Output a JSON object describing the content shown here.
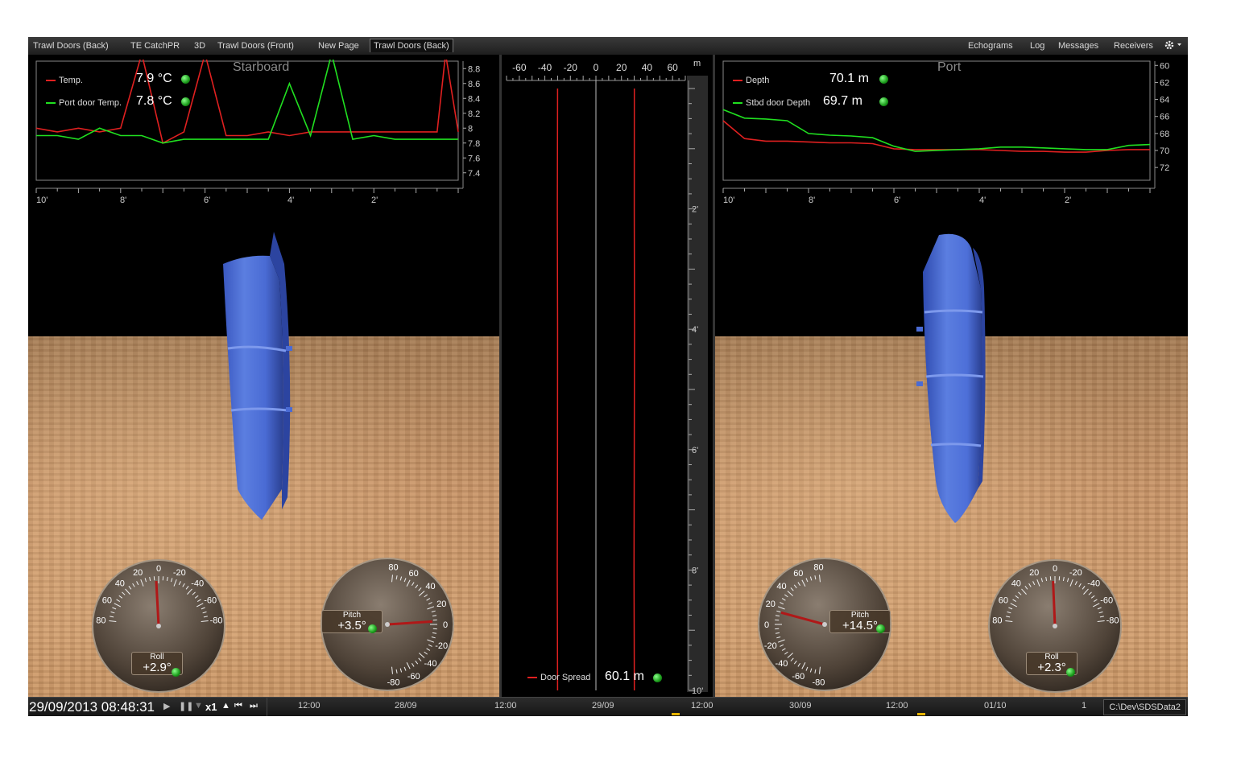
{
  "tabs": {
    "left": [
      {
        "label": "Trawl Doors (Back)"
      },
      {
        "label": "TE CatchPR"
      },
      {
        "label": "3D"
      },
      {
        "label": "Trawl Doors (Front)"
      },
      {
        "label": "New Page"
      },
      {
        "label": "Trawl Doors (Back)"
      }
    ],
    "active_index": 5,
    "right": [
      {
        "label": "Echograms"
      },
      {
        "label": "Log"
      },
      {
        "label": "Messages"
      },
      {
        "label": "Receivers"
      }
    ],
    "settings_icon": "gear-icon"
  },
  "starboard": {
    "title": "Starboard",
    "legend": [
      {
        "label": "Temp.",
        "value": "7.9 °C",
        "color": "#e02020"
      },
      {
        "label": "Port door Temp.",
        "value": "7.8 °C",
        "color": "#20e020"
      }
    ],
    "x_ticks": [
      "10'",
      "8'",
      "6'",
      "4'",
      "2'"
    ],
    "y_ticks": [
      "8.8",
      "8.6",
      "8.4",
      "8.2",
      "8",
      "7.8",
      "7.6",
      "7.4"
    ],
    "roll": {
      "label": "Roll",
      "value": "+2.9°",
      "deg": 2.9
    },
    "pitch": {
      "label": "Pitch",
      "value": "+3.5°",
      "deg": 3.5
    },
    "roll_scale": [
      "80",
      "60",
      "40",
      "20",
      "0",
      "-20",
      "-40",
      "-60",
      "-80"
    ],
    "pitch_scale": [
      "80",
      "60",
      "40",
      "20",
      "0",
      "-20",
      "-40",
      "-60",
      "-80"
    ]
  },
  "port": {
    "title": "Port",
    "legend": [
      {
        "label": "Depth",
        "value": "70.1 m",
        "color": "#e02020"
      },
      {
        "label": "Stbd door Depth",
        "value": "69.7 m",
        "color": "#20e020"
      }
    ],
    "x_ticks": [
      "10'",
      "8'",
      "6'",
      "4'",
      "2'"
    ],
    "y_ticks": [
      "60",
      "62",
      "64",
      "66",
      "68",
      "70",
      "72"
    ],
    "pitch": {
      "label": "Pitch",
      "value": "+14.5°",
      "deg": 14.5
    },
    "roll": {
      "label": "Roll",
      "value": "+2.3°",
      "deg": 2.3
    },
    "pitch_scale": [
      "80",
      "60",
      "40",
      "20",
      "0",
      "-20",
      "-40",
      "-60",
      "-80"
    ],
    "roll_scale": [
      "80",
      "60",
      "40",
      "20",
      "0",
      "-20",
      "-40",
      "-60",
      "-80"
    ]
  },
  "spread": {
    "x_ticks": [
      "-60",
      "-40",
      "-20",
      "0",
      "20",
      "40",
      "60"
    ],
    "unit": "m",
    "y_ticks": [
      "2'",
      "4'",
      "6'",
      "8'",
      "10'"
    ],
    "legend_label": "Door Spread",
    "value": "60.1 m",
    "color": "#e02020"
  },
  "status": {
    "datetime": "29/09/2013 08:48:31",
    "speed": "x1",
    "timeline": [
      "12:00",
      "28/09",
      "12:00",
      "29/09",
      "12:00",
      "30/09",
      "12:00",
      "01/10",
      "1"
    ],
    "path": "C:\\Dev\\SDSData2"
  },
  "chart_data": [
    {
      "type": "line",
      "title": "Starboard",
      "x": [
        10,
        9.5,
        9,
        8.5,
        8,
        7.5,
        7,
        6.5,
        6,
        5.5,
        5,
        4.5,
        4,
        3.5,
        3,
        2.5,
        2,
        1.5,
        1,
        0.5,
        0.3,
        0
      ],
      "series": [
        {
          "name": "Temp.",
          "values": [
            8.0,
            7.95,
            8.0,
            7.95,
            8.0,
            9.0,
            7.8,
            7.95,
            9.0,
            7.9,
            7.9,
            7.95,
            7.9,
            7.95,
            7.95,
            7.95,
            7.95,
            7.95,
            7.95,
            7.95,
            9.0,
            7.95
          ]
        },
        {
          "name": "Port door Temp.",
          "values": [
            7.9,
            7.9,
            7.85,
            8.0,
            7.9,
            7.9,
            7.8,
            7.85,
            7.85,
            7.85,
            7.85,
            7.85,
            8.6,
            7.9,
            9.0,
            7.85,
            7.9,
            7.85,
            7.85,
            7.85,
            7.85,
            7.85
          ]
        }
      ],
      "xlabel": "",
      "ylabel": "",
      "ylim": [
        7.3,
        8.9
      ]
    },
    {
      "type": "line",
      "title": "Port",
      "x": [
        10,
        9.5,
        9,
        8.5,
        8,
        7.5,
        7,
        6.5,
        6,
        5.5,
        5,
        4.5,
        4,
        3.5,
        3,
        2.5,
        2,
        1.5,
        1,
        0.5,
        0
      ],
      "series": [
        {
          "name": "Depth",
          "values": [
            66.5,
            68.6,
            68.9,
            68.9,
            69.0,
            69.1,
            69.1,
            69.2,
            69.8,
            69.9,
            69.9,
            69.9,
            69.9,
            70.0,
            70.1,
            70.1,
            70.2,
            70.2,
            70.0,
            69.9,
            69.9
          ]
        },
        {
          "name": "Stbd door Depth",
          "values": [
            65.2,
            66.2,
            66.3,
            66.5,
            68.0,
            68.2,
            68.3,
            68.5,
            69.5,
            70.1,
            70.0,
            69.9,
            69.8,
            69.6,
            69.6,
            69.7,
            69.8,
            69.9,
            69.9,
            69.4,
            69.3
          ]
        }
      ],
      "xlabel": "",
      "ylabel": "",
      "ylim": [
        59.5,
        73.5
      ],
      "y_inverted": true
    },
    {
      "type": "line",
      "title": "",
      "y_time": [
        0,
        2,
        4,
        6,
        8,
        10
      ],
      "series": [
        {
          "name": "Door Spread",
          "left": [
            -30.0,
            -30.2,
            -30.0,
            -30.1,
            -30.3,
            -30.0
          ],
          "right": [
            30.1,
            30.0,
            30.2,
            30.0,
            29.8,
            30.1
          ]
        }
      ],
      "xlim": [
        -70,
        70
      ],
      "ylabel": "m"
    }
  ]
}
